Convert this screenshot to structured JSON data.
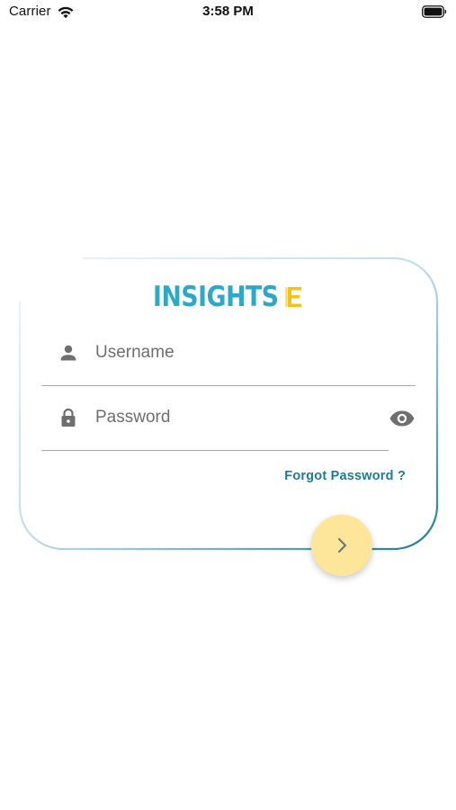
{
  "status_bar": {
    "carrier": "Carrier",
    "time": "3:58 PM"
  },
  "login": {
    "logo_text": "INSIGHTS",
    "username_placeholder": "Username",
    "password_placeholder": "Password",
    "forgot_password": "Forgot Password ?"
  },
  "colors": {
    "brand_blue": "#2ea8c7",
    "brand_yellow": "#f3c11b",
    "link": "#1e7a95",
    "fab_background": "#fde59a",
    "card_border_start": "#c9e2ea",
    "card_border_end": "#1d7d98"
  },
  "icons": {
    "username": "person-icon",
    "password": "lock-icon",
    "show_password": "eye-icon",
    "submit": "chevron-right-icon"
  }
}
